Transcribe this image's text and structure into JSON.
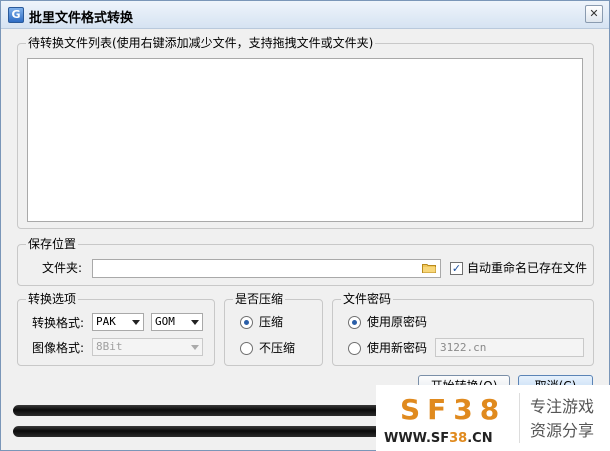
{
  "window": {
    "title": "批里文件格式转换",
    "icon_letter": "G",
    "close_glyph": "✕"
  },
  "file_list": {
    "legend": "待转换文件列表(使用右键添加减少文件，支持拖拽文件或文件夹)"
  },
  "save": {
    "legend": "保存位置",
    "folder_label": "文件夹:",
    "folder_value": "",
    "auto_rename_label": "自动重命名已存在文件",
    "auto_rename_checked": true
  },
  "convert": {
    "legend": "转换选项",
    "format_label": "转换格式:",
    "format_from": "PAK",
    "format_to": "GOM",
    "image_label": "图像格式:",
    "image_value": "8Bit"
  },
  "compress": {
    "legend": "是否压缩",
    "yes_label": "压缩",
    "no_label": "不压缩",
    "selected": "yes"
  },
  "password": {
    "legend": "文件密码",
    "original_label": "使用原密码",
    "new_label": "使用新密码",
    "new_value": "3122.cn",
    "selected": "original"
  },
  "buttons": {
    "start": "开始转换(O)",
    "cancel": "取消(C)"
  },
  "watermark": {
    "logo": "SF38",
    "url_prefix": "WWW.SF",
    "url_highlight": "38",
    "url_suffix": ".CN",
    "tag1": "专注游戏",
    "tag2": "资源分享",
    "color": "#e08a1e"
  },
  "icons": {
    "app": "app-icon",
    "close": "close-icon",
    "folder": "folder-icon",
    "dropdown": "chevron-down-icon"
  }
}
